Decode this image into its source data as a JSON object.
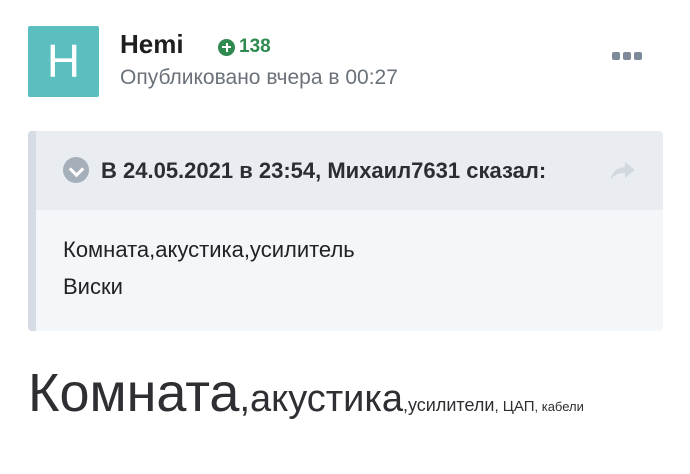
{
  "post": {
    "avatar_letter": "H",
    "avatar_color": "#5bbfc0",
    "author": "Hemi",
    "reputation_icon": "plus-circle-icon",
    "reputation": "138",
    "reputation_color": "#2e8a4e",
    "published": "Опубликовано вчера в 00:27",
    "more_icon": "more-dots-icon"
  },
  "quote": {
    "collapse_icon": "chevron-down-icon",
    "title": "В 24.05.2021 в 23:54, Михаил7631 сказал:",
    "share_icon": "share-arrow-icon",
    "lines": [
      "Комната,акустика,усилитель",
      "Виски"
    ]
  },
  "content": {
    "segments": [
      "Комната",
      ",акустика",
      ",усилители",
      ", ЦАП",
      ", кабели"
    ]
  }
}
